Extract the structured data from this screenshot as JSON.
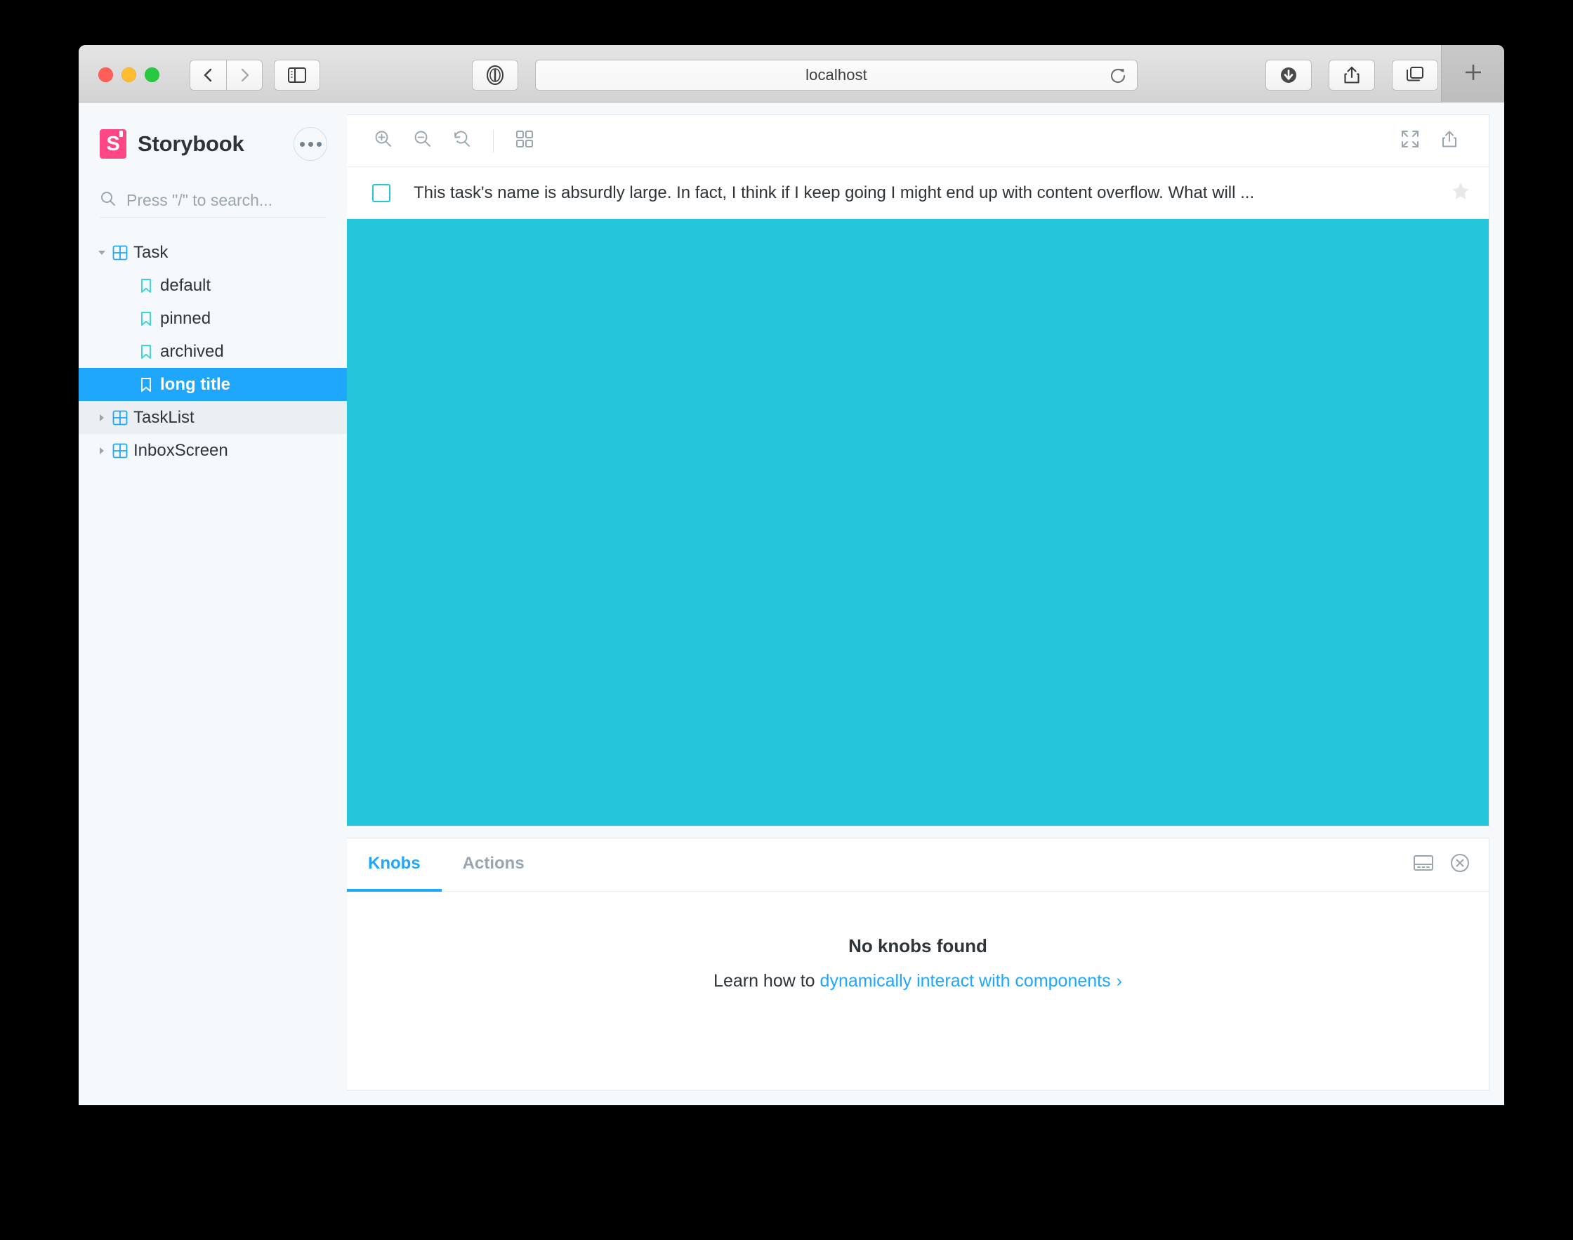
{
  "browser": {
    "url_text": "localhost",
    "traffic_lights": [
      "close",
      "minimize",
      "maximize"
    ],
    "back_icon": "chevron-left-icon",
    "forward_icon": "chevron-right-icon",
    "sidebar_toggle_icon": "sidebar-icon",
    "reader_icon": "reader-mode-icon",
    "reload_icon": "reload-icon",
    "download_icon": "download-icon",
    "share_icon": "share-icon",
    "tab_overview_icon": "tab-overview-icon",
    "new_tab_label": "+"
  },
  "sidebar": {
    "brand": "Storybook",
    "logo_letter": "S",
    "logo_color": "#ff4785",
    "menu_icon": "ellipsis-icon",
    "search": {
      "placeholder": "Press \"/\" to search...",
      "icon": "search-icon",
      "value": ""
    },
    "tree": [
      {
        "label": "Task",
        "type": "component",
        "icon": "component-grid-icon",
        "depth": 0,
        "expanded": true,
        "state": "normal"
      },
      {
        "label": "default",
        "type": "story",
        "icon": "bookmark-icon",
        "depth": 1,
        "expanded": null,
        "state": "normal"
      },
      {
        "label": "pinned",
        "type": "story",
        "icon": "bookmark-icon",
        "depth": 1,
        "expanded": null,
        "state": "normal"
      },
      {
        "label": "archived",
        "type": "story",
        "icon": "bookmark-icon",
        "depth": 1,
        "expanded": null,
        "state": "normal"
      },
      {
        "label": "long title",
        "type": "story",
        "icon": "bookmark-icon",
        "depth": 1,
        "expanded": null,
        "state": "selected"
      },
      {
        "label": "TaskList",
        "type": "component",
        "icon": "component-grid-icon",
        "depth": 0,
        "expanded": false,
        "state": "hover"
      },
      {
        "label": "InboxScreen",
        "type": "component",
        "icon": "component-grid-icon",
        "depth": 0,
        "expanded": false,
        "state": "normal"
      }
    ],
    "selected_accent": "#1ea7fd",
    "story_icon_color": "#37d5d3",
    "component_icon_color": "#1ea7fd"
  },
  "canvas_toolbar": {
    "zoom_in_icon": "zoom-in-icon",
    "zoom_out_icon": "zoom-out-icon",
    "zoom_reset_icon": "zoom-reset-icon",
    "grid_icon": "grid-backgrounds-icon",
    "fullscreen_icon": "expand-icon",
    "open_new_icon": "share-icon"
  },
  "story": {
    "title": "This task's name is absurdly large. In fact, I think if I keep going I might end up with content overflow. What will ...",
    "checkbox_checked": false,
    "checkbox_color": "#26c6da",
    "star_icon": "star-icon",
    "star_active": false,
    "canvas_background": "#26c6da"
  },
  "addon_panel": {
    "tabs": [
      {
        "label": "Knobs",
        "active": true
      },
      {
        "label": "Actions",
        "active": false
      }
    ],
    "layout_icon": "panel-position-icon",
    "close_icon": "close-circle-icon",
    "empty_title": "No knobs found",
    "empty_prefix": "Learn how to ",
    "empty_link": "dynamically interact with components",
    "empty_link_chevron": "›"
  }
}
